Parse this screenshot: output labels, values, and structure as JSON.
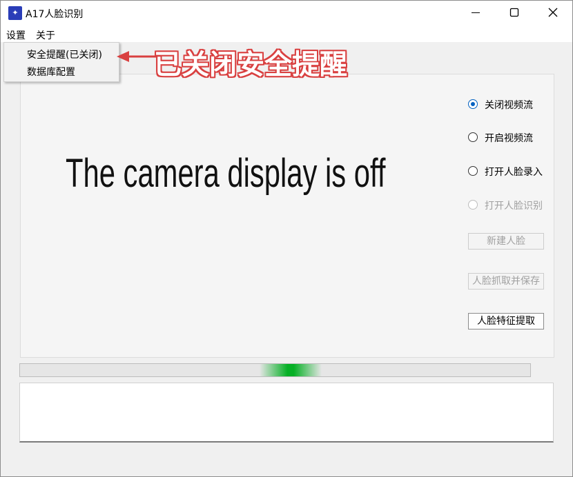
{
  "window": {
    "title": "A17人脸识别",
    "icon": "app-icon",
    "minimize_label": "─",
    "close_label": "✕"
  },
  "menubar": {
    "settings": "设置",
    "about": "关于"
  },
  "settings_menu": {
    "items": [
      "安全提醒(已关闭)",
      "数据库配置"
    ]
  },
  "annotation": {
    "text": "已关闭安全提醒",
    "color": "#d94040"
  },
  "camera": {
    "status_text": "The camera display is off"
  },
  "controls": {
    "radios": [
      {
        "label": "关闭视频流",
        "checked": true,
        "enabled": true
      },
      {
        "label": "开启视频流",
        "checked": false,
        "enabled": true
      },
      {
        "label": "打开人脸录入",
        "checked": false,
        "enabled": true
      },
      {
        "label": "打开人脸识别",
        "checked": false,
        "enabled": false
      }
    ],
    "buttons": [
      {
        "label": "新建人脸",
        "enabled": false
      },
      {
        "label": "人脸抓取并保存",
        "enabled": false
      },
      {
        "label": "人脸特征提取",
        "enabled": true
      }
    ]
  },
  "progress": {
    "mode": "indeterminate",
    "chunk_position": 0.53,
    "color": "#06b025"
  },
  "log": {
    "text": ""
  },
  "colors": {
    "accent": "#0060c0",
    "window_bg": "#f0f0f0"
  }
}
